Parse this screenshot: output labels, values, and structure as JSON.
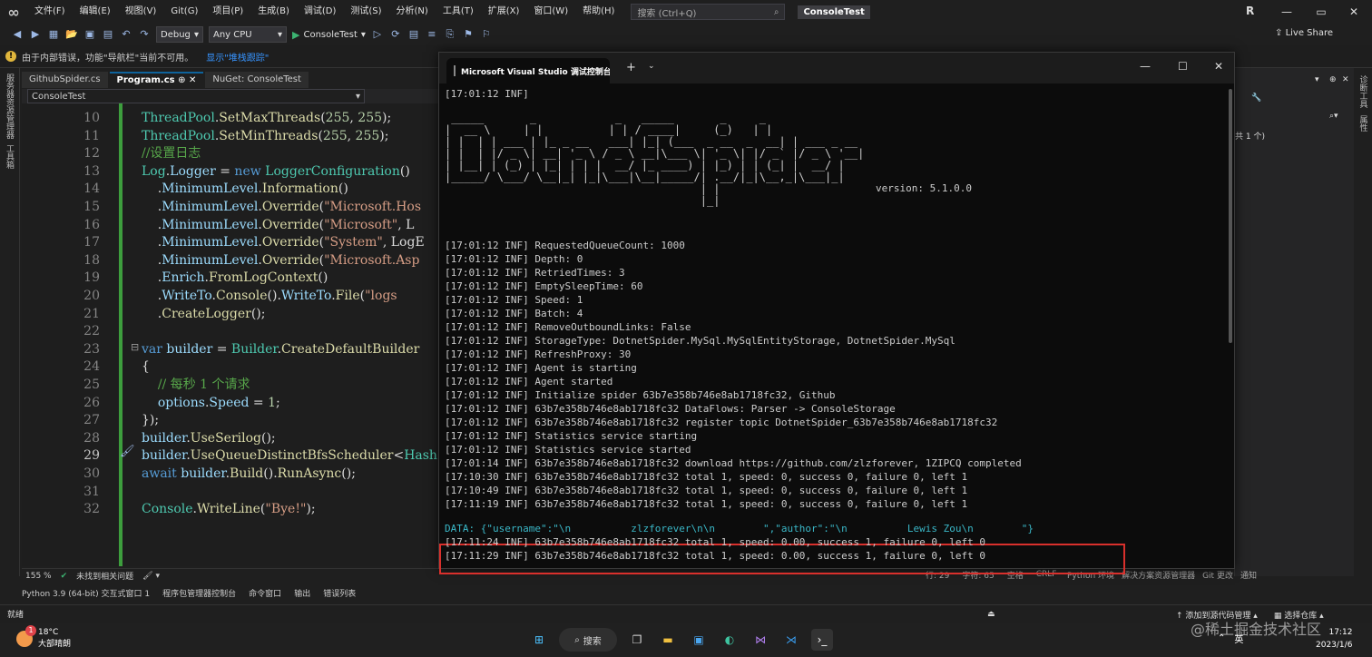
{
  "menubar": {
    "items": [
      "文件(F)",
      "编辑(E)",
      "视图(V)",
      "Git(G)",
      "项目(P)",
      "生成(B)",
      "调试(D)",
      "测试(S)",
      "分析(N)",
      "工具(T)",
      "扩展(X)",
      "窗口(W)",
      "帮助(H)"
    ],
    "search_placeholder": "搜索 (Ctrl+Q)",
    "solution_name": "ConsoleTest",
    "profile_initial": "R"
  },
  "toolbar": {
    "config": "Debug",
    "platform": "Any CPU",
    "run_label": "ConsoleTest",
    "liveshare": "Live Share"
  },
  "infobar": {
    "message": "由于内部错误，功能\"导航栏\"当前不可用。",
    "link": "显示\"堆栈跟踪\""
  },
  "left_strip": [
    "服务器资源管理器",
    "工具箱"
  ],
  "tabs": [
    {
      "label": "GithubSpider.cs",
      "active": false
    },
    {
      "label": "Program.cs",
      "active": true
    },
    {
      "label": "NuGet: ConsoleTest",
      "active": false
    }
  ],
  "nav": {
    "project": "ConsoleTest"
  },
  "editor": {
    "lines": [
      {
        "n": "10",
        "html": "<span class=\"c-type\">ThreadPool</span><span class=\"c-plain\">.</span><span class=\"c-meth\">SetMaxThreads</span><span class=\"c-plain\">(</span><span class=\"c-num\">255</span><span class=\"c-plain\">, </span><span class=\"c-num\">255</span><span class=\"c-plain\">);</span>"
      },
      {
        "n": "11",
        "html": "<span class=\"c-type\">ThreadPool</span><span class=\"c-plain\">.</span><span class=\"c-meth\">SetMinThreads</span><span class=\"c-plain\">(</span><span class=\"c-num\">255</span><span class=\"c-plain\">, </span><span class=\"c-num\">255</span><span class=\"c-plain\">);</span>"
      },
      {
        "n": "12",
        "html": "<span class=\"c-cm\">//设置日志</span>"
      },
      {
        "n": "13",
        "html": "<span class=\"c-type\">Log</span><span class=\"c-plain\">.</span><span class=\"c-id\">Logger</span><span class=\"c-plain\"> = </span><span class=\"c-kw\">new</span><span class=\"c-plain\"> </span><span class=\"c-type\">LoggerConfiguration</span><span class=\"c-plain\">()</span>"
      },
      {
        "n": "14",
        "html": "<span class=\"c-plain\">    .</span><span class=\"c-id\">MinimumLevel</span><span class=\"c-plain\">.</span><span class=\"c-meth\">Information</span><span class=\"c-plain\">()</span>"
      },
      {
        "n": "15",
        "html": "<span class=\"c-plain\">    .</span><span class=\"c-id\">MinimumLevel</span><span class=\"c-plain\">.</span><span class=\"c-meth\">Override</span><span class=\"c-plain\">(</span><span class=\"c-str\">\"Microsoft.Hos</span>"
      },
      {
        "n": "16",
        "html": "<span class=\"c-plain\">    .</span><span class=\"c-id\">MinimumLevel</span><span class=\"c-plain\">.</span><span class=\"c-meth\">Override</span><span class=\"c-plain\">(</span><span class=\"c-str\">\"Microsoft\"</span><span class=\"c-plain\">, L</span>"
      },
      {
        "n": "17",
        "html": "<span class=\"c-plain\">    .</span><span class=\"c-id\">MinimumLevel</span><span class=\"c-plain\">.</span><span class=\"c-meth\">Override</span><span class=\"c-plain\">(</span><span class=\"c-str\">\"System\"</span><span class=\"c-plain\">, LogE</span>"
      },
      {
        "n": "18",
        "html": "<span class=\"c-plain\">    .</span><span class=\"c-id\">MinimumLevel</span><span class=\"c-plain\">.</span><span class=\"c-meth\">Override</span><span class=\"c-plain\">(</span><span class=\"c-str\">\"Microsoft.Asp</span>"
      },
      {
        "n": "19",
        "html": "<span class=\"c-plain\">    .</span><span class=\"c-id\">Enrich</span><span class=\"c-plain\">.</span><span class=\"c-meth\">FromLogContext</span><span class=\"c-plain\">()</span>"
      },
      {
        "n": "20",
        "html": "<span class=\"c-plain\">    .</span><span class=\"c-id\">WriteTo</span><span class=\"c-plain\">.</span><span class=\"c-meth\">Console</span><span class=\"c-plain\">().</span><span class=\"c-id\">WriteTo</span><span class=\"c-plain\">.</span><span class=\"c-meth\">File</span><span class=\"c-plain\">(</span><span class=\"c-str\">\"logs</span>"
      },
      {
        "n": "21",
        "html": "<span class=\"c-plain\">    .</span><span class=\"c-meth\">CreateLogger</span><span class=\"c-plain\">();</span>"
      },
      {
        "n": "22",
        "html": ""
      },
      {
        "n": "23",
        "html": "<span class=\"c-kw\">var</span><span class=\"c-plain\"> </span><span class=\"c-id\">builder</span><span class=\"c-plain\"> = </span><span class=\"c-type\">Builder</span><span class=\"c-plain\">.</span><span class=\"c-meth\">CreateDefaultBuilder</span>"
      },
      {
        "n": "24",
        "html": "<span class=\"c-plain\">{</span>"
      },
      {
        "n": "25",
        "html": "<span class=\"c-plain\">    </span><span class=\"c-cm\">// 每秒 1 个请求</span>"
      },
      {
        "n": "26",
        "html": "<span class=\"c-plain\">    </span><span class=\"c-id\">options</span><span class=\"c-plain\">.</span><span class=\"c-id\">Speed</span><span class=\"c-plain\"> = </span><span class=\"c-num\">1</span><span class=\"c-plain\">;</span>"
      },
      {
        "n": "27",
        "html": "<span class=\"c-plain\">});</span>"
      },
      {
        "n": "28",
        "html": "<span class=\"c-id\">builder</span><span class=\"c-plain\">.</span><span class=\"c-meth\">UseSerilog</span><span class=\"c-plain\">();</span>"
      },
      {
        "n": "29",
        "html": "<span class=\"c-id\">builder</span><span class=\"c-plain\">.</span><span class=\"c-meth\">UseQueueDistinctBfsScheduler</span><span class=\"c-plain\">&lt;</span><span class=\"c-type\">Hash</span>"
      },
      {
        "n": "30",
        "html": "<span class=\"c-kw\">await</span><span class=\"c-plain\"> </span><span class=\"c-id\">builder</span><span class=\"c-plain\">.</span><span class=\"c-meth\">Build</span><span class=\"c-plain\">().</span><span class=\"c-meth\">RunAsync</span><span class=\"c-plain\">();</span>"
      },
      {
        "n": "31",
        "html": ""
      },
      {
        "n": "32",
        "html": "<span class=\"c-type\">Console</span><span class=\"c-plain\">.</span><span class=\"c-meth\">WriteLine</span><span class=\"c-plain\">(</span><span class=\"c-str\">\"Bye!\"</span><span class=\"c-plain\">);</span>"
      }
    ],
    "current_line": "29"
  },
  "editor_status": {
    "zoom": "155 %",
    "issues": "未找到相关问题"
  },
  "position": {
    "line": "行: 29",
    "col": "字符: 65",
    "spaces": "空格",
    "eol": "CRLF"
  },
  "bottom_tabs": [
    "Python 环境",
    "解决方案资源管理器",
    "Git 更改",
    "通知"
  ],
  "tool_tabs": [
    "Python 3.9 (64-bit) 交互式窗口 1",
    "程序包管理器控制台",
    "命令窗口",
    "输出",
    "错误列表"
  ],
  "right_panel": {
    "text1": "共 1 个)",
    "strip": [
      "诊断工具",
      "属性"
    ]
  },
  "statusbar": {
    "ready": "就绪",
    "source_control": "添加到源代码管理",
    "repo": "选择仓库"
  },
  "taskbar": {
    "temp": "18°C",
    "weather": "大部晴朗",
    "notif_count": "1",
    "search": "搜索",
    "ime": "英",
    "time": "17:12",
    "date": "2023/1/6",
    "watermark": "@稀土掘金技术社区"
  },
  "terminal": {
    "tab_title": "Microsoft Visual Studio 调试控制台",
    "first_line": "[17:01:12 INF]",
    "ascii_art": " _____       _            _   _____       _     _\n|  __ \\     | |          | | / ____|     (_)   | |\n| |  | | ___ | |_ _ __   ___| |_| (___  _ __  _  __| | ___ _ __\n| |  | |/ _ \\| __| '_ \\ / _ \\ __|\\___ \\| '_ \\| |/ _` |/ _ \\ '__|\n| |__| | (_) | |_| | | |  __/ |_ ____) | |_) | | (_| |  __/ |\n|_____/ \\___/ \\__|_| |_|\\___|\\__|_____/| .__/|_|\\__,_|\\___|_|\n                                       | |\n                                       |_|",
    "version": "version: 5.1.0.0",
    "log_lines": [
      "[17:01:12 INF] RequestedQueueCount: 1000",
      "[17:01:12 INF] Depth: 0",
      "[17:01:12 INF] RetriedTimes: 3",
      "[17:01:12 INF] EmptySleepTime: 60",
      "[17:01:12 INF] Speed: 1",
      "[17:01:12 INF] Batch: 4",
      "[17:01:12 INF] RemoveOutboundLinks: False",
      "[17:01:12 INF] StorageType: DotnetSpider.MySql.MySqlEntityStorage, DotnetSpider.MySql",
      "[17:01:12 INF] RefreshProxy: 30",
      "[17:01:12 INF] Agent is starting",
      "[17:01:12 INF] Agent started",
      "[17:01:12 INF] Initialize spider 63b7e358b746e8ab1718fc32, Github",
      "[17:01:12 INF] 63b7e358b746e8ab1718fc32 DataFlows: Parser -> ConsoleStorage",
      "[17:01:12 INF] 63b7e358b746e8ab1718fc32 register topic DotnetSpider_63b7e358b746e8ab1718fc32",
      "[17:01:12 INF] Statistics service starting",
      "[17:01:12 INF] Statistics service started",
      "[17:01:14 INF] 63b7e358b746e8ab1718fc32 download https://github.com/zlzforever, 1ZIPCQ completed",
      "[17:10:30 INF] 63b7e358b746e8ab1718fc32 total 1, speed: 0, success 0, failure 0, left 1",
      "[17:10:49 INF] 63b7e358b746e8ab1718fc32 total 1, speed: 0, success 0, failure 0, left 1",
      "[17:11:19 INF] 63b7e358b746e8ab1718fc32 total 1, speed: 0, success 0, failure 0, left 1"
    ],
    "data_line": "DATA: {\"username\":\"\\n          zlzforever\\n\\n        \",\"author\":\"\\n          Lewis Zou\\n        \"}",
    "tail_lines": [
      "[17:11:24 INF] 63b7e358b746e8ab1718fc32 total 1, speed: 0.00, success 1, failure 0, left 0",
      "[17:11:29 INF] 63b7e358b746e8ab1718fc32 total 1, speed: 0.00, success 1, failure 0, left 0"
    ]
  }
}
